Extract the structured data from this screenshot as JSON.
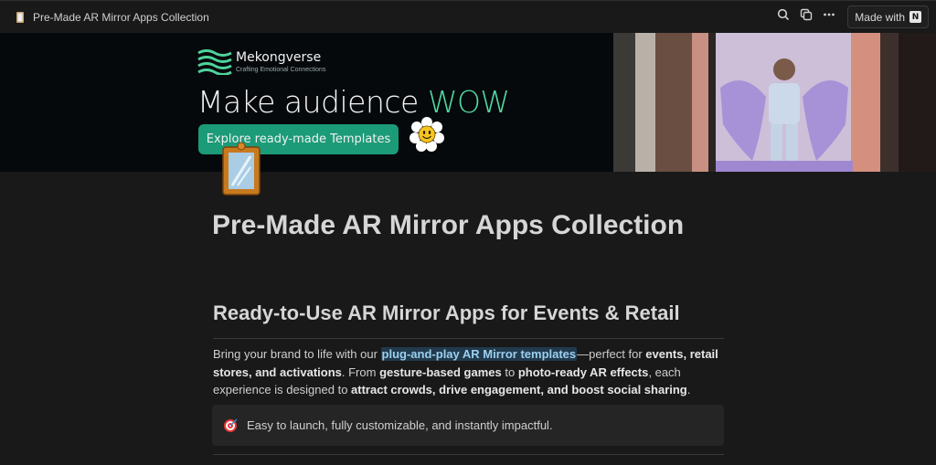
{
  "topbar": {
    "page_title": "Pre-Made AR Mirror Apps Collection",
    "made_with_label": "Made with",
    "icons": [
      "page-icon",
      "search-icon",
      "duplicate-icon",
      "more-icon",
      "notion-logo-icon"
    ]
  },
  "banner": {
    "brand_name": "Mekongverse",
    "brand_tagline": "Crafting Emotional Connections",
    "headline_prefix": "Make audience ",
    "headline_accent": "WOW",
    "cta_label": "Explore ready-made Templates",
    "colors": {
      "background": "#05090c",
      "accent": "#52d9a0",
      "cta": "#1c9b78"
    }
  },
  "page": {
    "title": "Pre-Made AR Mirror Apps Collection",
    "section_heading": "Ready-to-Use AR Mirror Apps for Events & Retail",
    "paragraph": {
      "t1": "Bring your brand to life with our ",
      "highlight": "plug-and-play AR Mirror templates",
      "t2": "—perfect for ",
      "b1": "events, retail stores, and activations",
      "t3": ". From ",
      "b2": "gesture-based games",
      "t4": " to ",
      "b3": "photo-ready AR effects",
      "t5": ", each experience is designed to ",
      "b4": "attract crowds, drive engagement, and boost social sharing",
      "t6": "."
    },
    "callout": {
      "icon": "target-icon",
      "text": "Easy to launch, fully customizable, and instantly impactful."
    }
  }
}
